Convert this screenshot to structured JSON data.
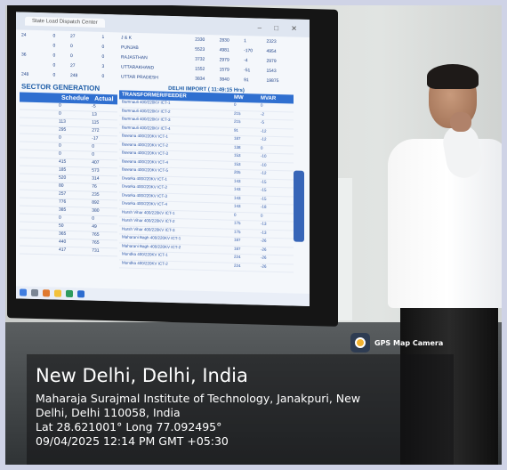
{
  "screen": {
    "browser_tab": "State Load Dispatch Center",
    "sector_title": "SECTOR GENERATION",
    "generation_headers": [
      "Schedule",
      "Actual"
    ],
    "generation_rows": [
      [
        "0",
        "-5"
      ],
      [
        "0",
        "13"
      ],
      [
        "113",
        "115"
      ],
      [
        "295",
        "272"
      ],
      [
        "0",
        "-17"
      ],
      [
        "0",
        "0"
      ],
      [
        "0",
        "0"
      ],
      [
        "415",
        "407"
      ],
      [
        "185",
        "573"
      ],
      [
        "520",
        "314"
      ],
      [
        "80",
        "76"
      ],
      [
        "257",
        "235"
      ],
      [
        "776",
        "892"
      ],
      [
        "385",
        "380"
      ],
      [
        "0",
        "0"
      ],
      [
        "50",
        "49"
      ],
      [
        "365",
        "765"
      ],
      [
        "440",
        "765"
      ],
      [
        "417",
        "731"
      ]
    ],
    "delhi_import_title": "DELHI IMPORT ( 11:49:15 Hrs)",
    "transformer_headers": [
      "TRANSFORMER/FEEDER",
      "MW",
      "MVAR"
    ],
    "transformer_rows": [
      [
        "Bamnauli 400/220KV ICT-1",
        "0",
        "0"
      ],
      [
        "Bamnauli 400/220KV ICT-2",
        "215",
        "-2"
      ],
      [
        "Bamnauli 400/220KV ICT-3",
        "215",
        "-5"
      ],
      [
        "Bamnauli 400/220KV ICT-4",
        "91",
        "-12"
      ],
      [
        "Bawana 400/220KV ICT-1",
        "187",
        "-12"
      ],
      [
        "Bawana 400/220KV ICT-2",
        "138",
        "0"
      ],
      [
        "Bawana 400/220KV ICT-3",
        "153",
        "-10"
      ],
      [
        "Bawana 400/220KV ICT-4",
        "153",
        "-10"
      ],
      [
        "Bawana 400/220KV ICT-5",
        "205",
        "-12"
      ],
      [
        "Dwarka 400/220KV ICT-1",
        "143",
        "-15"
      ],
      [
        "Dwarka 400/220KV ICT-2",
        "143",
        "-15"
      ],
      [
        "Dwarka 400/220KV ICT-3",
        "143",
        "-15"
      ],
      [
        "Dwarka 400/220KV ICT-4",
        "143",
        "-18"
      ],
      [
        "Harsh Vihar 400/220KV ICT-1",
        "0",
        "0"
      ],
      [
        "Harsh Vihar 400/220KV ICT-2",
        "175",
        "-13"
      ],
      [
        "Harsh Vihar 400/220KV ICT-3",
        "175",
        "-13"
      ],
      [
        "Maharani Bagh 400/220KV ICT-1",
        "187",
        "-26"
      ],
      [
        "Maharani Bagh 400/220KV ICT-2",
        "187",
        "-26"
      ],
      [
        "Mundka 400/220KV ICT-1",
        "224",
        "-26"
      ],
      [
        "Mundka 400/220KV ICT-2",
        "224",
        "-26"
      ]
    ],
    "top_right_rows": [
      [
        "J & K",
        "2330",
        "2830",
        "1",
        "2323"
      ],
      [
        "PUNJAB",
        "5523",
        "4981",
        "-170",
        "4954"
      ],
      [
        "RAJASTHAN",
        "3732",
        "2979",
        "-4",
        "2979"
      ],
      [
        "UTTARAKHAND",
        "1552",
        "1579",
        "-51",
        "1543"
      ],
      [
        "UTTAR PRADESH",
        "3834",
        "3840",
        "91",
        "19875"
      ]
    ],
    "top_left_rows": [
      [
        "24",
        "0",
        "27",
        "1"
      ],
      [
        "",
        "0",
        "0",
        "0"
      ],
      [
        "36",
        "0",
        "0",
        "0"
      ],
      [
        "",
        "0",
        "27",
        "3"
      ],
      [
        "248",
        "0",
        "248",
        "0"
      ]
    ]
  },
  "overlay": {
    "badge": "GPS Map Camera",
    "location_title": "New Delhi, Delhi, India",
    "address_line1": "Maharaja Surajmal Institute of Technology, Janakpuri, New",
    "address_line2": "Delhi, Delhi 110058, India",
    "coordinates": "Lat 28.621001° Long 77.092495°",
    "timestamp": "09/04/2025 12:14 PM GMT +05:30"
  }
}
